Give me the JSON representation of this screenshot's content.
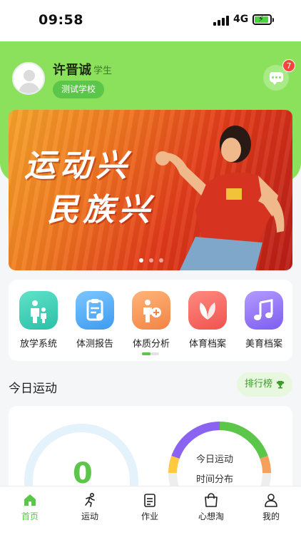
{
  "status_bar": {
    "time": "09:58",
    "network": "4G"
  },
  "user": {
    "name": "许晋诚",
    "role": "学生",
    "school": "测试学校",
    "unread_count": "7"
  },
  "banner": {
    "line1": "运动兴",
    "line2": "民族兴",
    "page_count": 3,
    "active_page": 1
  },
  "shortcuts": [
    {
      "label": "放学系统",
      "icon": "after-school-icon",
      "color": "#3fd1b8"
    },
    {
      "label": "体测报告",
      "icon": "test-report-icon",
      "color": "#5ab0f5"
    },
    {
      "label": "体质分析",
      "icon": "physique-analysis-icon",
      "color": "#f7a05c"
    },
    {
      "label": "体育档案",
      "icon": "sports-archive-icon",
      "color": "#f66a6a"
    },
    {
      "label": "美育档案",
      "icon": "art-archive-icon",
      "color": "#9a7cf5"
    }
  ],
  "today": {
    "title": "今日运动",
    "rank_label": "排行榜",
    "step_value": "0",
    "distribution_line1": "今日运动",
    "distribution_line2": "时间分布"
  },
  "tabs": [
    {
      "label": "首页",
      "icon": "home-icon",
      "active": true
    },
    {
      "label": "运动",
      "icon": "running-icon",
      "active": false
    },
    {
      "label": "作业",
      "icon": "homework-icon",
      "active": false
    },
    {
      "label": "心想淘",
      "icon": "shopping-bag-icon",
      "active": false
    },
    {
      "label": "我的",
      "icon": "profile-icon",
      "active": false
    }
  ],
  "colors": {
    "brand_green": "#5cc64a",
    "header_green": "#8be05c",
    "badge_red": "#f5443c"
  }
}
